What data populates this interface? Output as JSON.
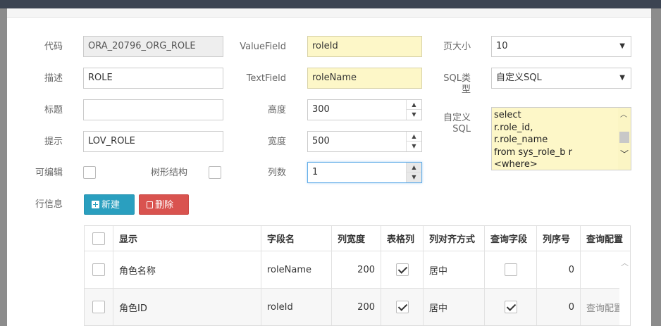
{
  "form": {
    "code": {
      "label": "代码",
      "value": "ORA_20796_ORG_ROLE"
    },
    "desc": {
      "label": "描述",
      "value": "ROLE"
    },
    "title": {
      "label": "标题",
      "value": ""
    },
    "hint": {
      "label": "提示",
      "value": "LOV_ROLE"
    },
    "editable": {
      "label": "可编辑",
      "checked": false
    },
    "tree": {
      "label": "树形结构",
      "checked": false
    },
    "value_field": {
      "label": "ValueField",
      "value": "roleId"
    },
    "text_field": {
      "label": "TextField",
      "value": "roleName"
    },
    "height": {
      "label": "高度",
      "value": "300"
    },
    "width": {
      "label": "宽度",
      "value": "500"
    },
    "columns": {
      "label": "列数",
      "value": "1"
    },
    "page_size": {
      "label": "页大小",
      "value": "10"
    },
    "sql_type": {
      "label_line1": "SQL类",
      "label_line2": "型",
      "value": "自定义SQL"
    },
    "custom_sql": {
      "label_line1": "自定义",
      "label_line2": "SQL",
      "lines": [
        "select",
        "r.role_id,",
        "r.role_name",
        "from sys_role_b r",
        "<where>"
      ]
    }
  },
  "row_info": {
    "label": "行信息",
    "new_button": "新建",
    "delete_button": "删除"
  },
  "grid": {
    "headers": [
      "显示",
      "字段名",
      "列宽度",
      "表格列",
      "列对齐方式",
      "查询字段",
      "列序号",
      "查询配置"
    ],
    "rows": [
      {
        "display": "角色名称",
        "field": "roleName",
        "width": "200",
        "table_col": true,
        "align": "居中",
        "query_field": false,
        "order": "0",
        "query_config": ""
      },
      {
        "display": "角色ID",
        "field": "roleId",
        "width": "200",
        "table_col": true,
        "align": "居中",
        "query_field": true,
        "order": "0",
        "query_config": "查询配置"
      }
    ]
  },
  "colors": {
    "primary": "#2a9fbf",
    "danger": "#d9534f",
    "highlight": "#fdf7c8"
  }
}
